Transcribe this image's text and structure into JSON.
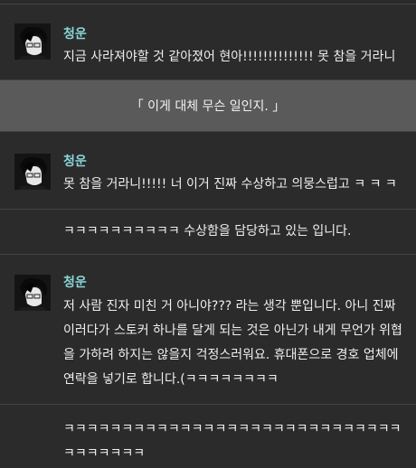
{
  "messages": [
    {
      "kind": "user",
      "name": "청운",
      "text": "지금 사라져야할 것 같아졌어 현아!!!!!!!!!!!!!! 못 참을 거라니"
    },
    {
      "kind": "system",
      "text": "「 이게 대체 무슨 일인지. 」"
    },
    {
      "kind": "user",
      "name": "청운",
      "text": "못 참을 거라니!!!!! 너 이거 진짜 수상하고 의뭉스럽고 ㅋ ㅋ ㅋ"
    },
    {
      "kind": "continuation",
      "text": "ㅋㅋㅋㅋㅋㅋㅋㅋㅋㅋ 수상함을 담당하고 있는        입니다."
    },
    {
      "kind": "user",
      "name": "청운",
      "text": "저 사람 진자 미친 거 아니야??? 라는 생각 뿐입니다. 아니 진짜 이러다가 스토커 하나를 달게 되는 것은 아닌가 내게 무언가 위협을 가하려 하지는 않을지 걱정스러워요. 휴대폰으로 경호 업체에 연락을 넣기로 합니다.(ㅋㅋㅋㅋㅋㅋㅋㅋ"
    },
    {
      "kind": "continuation",
      "text": "ㅋㅋㅋㅋㅋㅋㅋㅋㅋㅋㅋㅋㅋㅋㅋㅋㅋㅋㅋㅋㅋㅋㅋㅋㅋㅋㅋㅋㅋㅋㅋㅋㅋㅋㅋㅋ"
    }
  ],
  "colors": {
    "background": "#2b2b2b",
    "system_bar": "#5a5a5a",
    "name": "#8ad5d7",
    "divider": "#444444"
  },
  "icons": {
    "avatar": "profile-avatar-icon"
  }
}
